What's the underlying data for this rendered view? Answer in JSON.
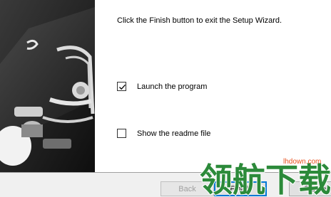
{
  "wizard": {
    "finish_text": "Click the Finish button to exit the Setup Wizard.",
    "options": [
      {
        "label": "Launch the program",
        "checked": true
      },
      {
        "label": "Show the readme file",
        "checked": false
      }
    ]
  },
  "buttons": {
    "back": "Back",
    "finish": "Finish",
    "cancel": "Cancel"
  },
  "watermark": {
    "url": "lhdown.com",
    "text": "领航下载"
  },
  "colors": {
    "accent": "#0078d7",
    "watermark": "#2c8a3a",
    "watermark_url": "#e8501e"
  }
}
